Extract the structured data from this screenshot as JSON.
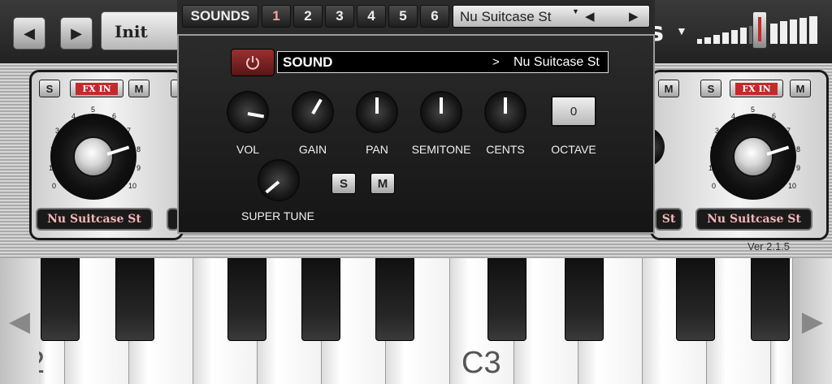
{
  "topbar": {
    "prev_icon": "triangle-left-icon",
    "next_icon": "triangle-right-icon",
    "preset_name": "Init",
    "brand_fragment": "s",
    "brand_menu_icon": "triangle-down-icon",
    "volume_meter_icon": "volume-meter-icon"
  },
  "sounds_bar": {
    "title": "SOUNDS",
    "tabs": [
      "1",
      "2",
      "3",
      "4",
      "5",
      "6"
    ],
    "active_tab": "1",
    "selected_sound": "Nu Suitcase St",
    "menu_icon": "small-triangle-down-icon",
    "prev_icon": "triangle-left-icon",
    "next_icon": "triangle-right-icon"
  },
  "sound_dialog": {
    "power_icon": "power-icon",
    "header_label": "SOUND",
    "header_arrow": ">",
    "header_value": "Nu Suitcase St",
    "knobs": [
      {
        "label": "VOL"
      },
      {
        "label": "GAIN"
      },
      {
        "label": "PAN"
      },
      {
        "label": "SEMITONE"
      },
      {
        "label": "CENTS"
      }
    ],
    "octave_value": "0",
    "octave_label": "OCTAVE",
    "super_tune_label": "SUPER TUNE",
    "solo_label": "S",
    "mute_label": "M"
  },
  "left_channel": {
    "solo_label": "S",
    "fx_label": "FX IN",
    "mute_label": "M",
    "scale": [
      "0",
      "1",
      "2",
      "3",
      "4",
      "5",
      "6",
      "7",
      "8",
      "9",
      "10"
    ],
    "name": "Nu Suitcase St"
  },
  "right_channel": {
    "solo_label": "S",
    "fx_label": "FX IN",
    "mute_label": "M",
    "scale": [
      "0",
      "1",
      "2",
      "3",
      "4",
      "5",
      "6",
      "7",
      "8",
      "9",
      "10"
    ],
    "name": "Nu Suitcase St"
  },
  "partial_name_fragment": "St",
  "version": "Ver 2.1.5",
  "keyboard": {
    "left_fragment": "2",
    "octave_label": "C3",
    "left_arrow_icon": "triangle-left-icon",
    "right_arrow_icon": "triangle-right-icon"
  },
  "colors": {
    "fx_red": "#c32a2a",
    "active_tab_text": "#f3a3a3",
    "channel_name_text": "#f4b6b6",
    "power_button": "#7a2020"
  }
}
